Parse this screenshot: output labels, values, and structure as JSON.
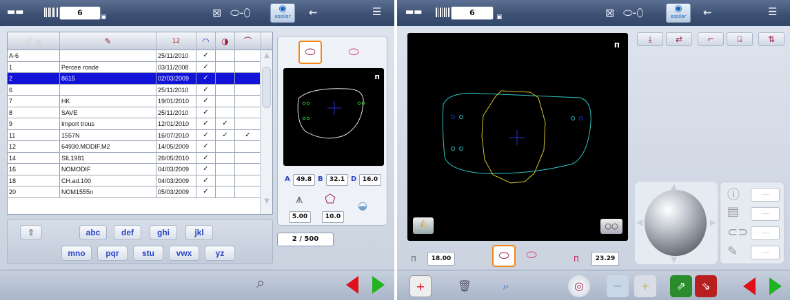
{
  "left": {
    "job_number": "6",
    "table": {
      "headers": [
        "#",
        "✎",
        "12",
        "",
        "",
        ""
      ],
      "rows": [
        {
          "id": "A-6",
          "name": "",
          "date": "25/11/2010",
          "c1": "✓",
          "c2": "",
          "c3": ""
        },
        {
          "id": "1",
          "name": "Percee ronde",
          "date": "03/11/2008",
          "c1": "✓",
          "c2": "",
          "c3": ""
        },
        {
          "id": "2",
          "name": "8615",
          "date": "02/03/2009",
          "c1": "✓",
          "c2": "",
          "c3": "",
          "selected": true
        },
        {
          "id": "6",
          "name": "",
          "date": "25/11/2010",
          "c1": "✓",
          "c2": "",
          "c3": ""
        },
        {
          "id": "7",
          "name": "HK",
          "date": "19/01/2010",
          "c1": "✓",
          "c2": "",
          "c3": ""
        },
        {
          "id": "8",
          "name": "SAVE",
          "date": "25/11/2010",
          "c1": "✓",
          "c2": "",
          "c3": ""
        },
        {
          "id": "9",
          "name": "Import trous",
          "date": "12/01/2010",
          "c1": "✓",
          "c2": "✓",
          "c3": ""
        },
        {
          "id": "11",
          "name": "1557N",
          "date": "16/07/2010",
          "c1": "✓",
          "c2": "✓",
          "c3": "✓"
        },
        {
          "id": "12",
          "name": "64930.MODIF.M2",
          "date": "14/05/2009",
          "c1": "✓",
          "c2": "",
          "c3": ""
        },
        {
          "id": "14",
          "name": "SIL1981",
          "date": "26/05/2010",
          "c1": "✓",
          "c2": "",
          "c3": ""
        },
        {
          "id": "16",
          "name": "NOMODIF",
          "date": "04/03/2009",
          "c1": "✓",
          "c2": "",
          "c3": ""
        },
        {
          "id": "18",
          "name": "CH.ad.100",
          "date": "04/03/2009",
          "c1": "✓",
          "c2": "",
          "c3": ""
        },
        {
          "id": "20",
          "name": "NOM1555n",
          "date": "05/03/2009",
          "c1": "✓",
          "c2": "",
          "c3": ""
        }
      ]
    },
    "keyboard": {
      "row1": [
        "abc",
        "def",
        "ghi",
        "jkl"
      ],
      "row2": [
        "mno",
        "pqr",
        "stu",
        "vwx",
        "yz"
      ]
    },
    "measures": {
      "a_label": "A",
      "a": "49.8",
      "b_label": "B",
      "b": "32.1",
      "d_label": "D",
      "d": "16.0"
    },
    "bevel": {
      "v1": "5.00",
      "v2": "10.0"
    },
    "counter": "2 / 500",
    "brand": "essilor"
  },
  "right": {
    "job_number": "6",
    "bridge_value": "18.00",
    "angle_value": "23.29",
    "side_values": [
      "----",
      "----",
      "----",
      "----"
    ],
    "brand": "essilor"
  },
  "colors": {
    "selected_row": "#1313d8",
    "arrow_prev": "#e0101a",
    "arrow_next": "#21b421",
    "lens_active": "#f2871a",
    "shape_cyan": "#2fc8c8",
    "shape_yellow": "#d6c826"
  }
}
